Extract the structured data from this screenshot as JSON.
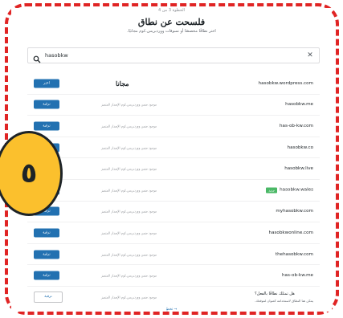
{
  "header": {
    "step": "الخطوة 3 من 4",
    "title": "فلسحت عن نطاق",
    "subtitle": "اختر نطاقًا مخصصًا أو نسوقات ووردبريس.كوم مجانيًا."
  },
  "search": {
    "value": "hasobkw",
    "icon": "search-icon",
    "clear_icon": "close-icon",
    "clear_glyph": "✕"
  },
  "rows": [
    {
      "domain": "hasobkw.wordpress.com",
      "price": "مجانا",
      "button": "اختر",
      "badge": ""
    },
    {
      "domain": "hasobkw.me",
      "price": "موجود ضمن ووردبريس.كوم الإصدار المتميز",
      "button": "ترقية",
      "badge": ""
    },
    {
      "domain": "has-ob-kw.com",
      "price": "موجود ضمن ووردبريس.كوم الإصدار المتميز",
      "button": "ترقية",
      "badge": ""
    },
    {
      "domain": "hasobkw.co",
      "price": "موجود ضمن ووردبريس.كوم الإصدار المتميز",
      "button": "ترقية",
      "badge": ""
    },
    {
      "domain": "hasobkw.live",
      "price": "موجود ضمن ووردبريس.كوم الإصدار المتميز",
      "button": "ترقية",
      "badge": ""
    },
    {
      "domain": "hasobkw.wales",
      "price": "موجود ضمن ووردبريس.كوم الإصدار المتميز",
      "button": "ترقية",
      "badge": "جديد"
    },
    {
      "domain": "myhasobkw.com",
      "price": "موجود ضمن ووردبريس.كوم الإصدار المتميز",
      "button": "ترقية",
      "badge": ""
    },
    {
      "domain": "hasobkwonline.com",
      "price": "موجود ضمن ووردبريس.كوم الإصدار المتميز",
      "button": "ترقية",
      "badge": ""
    },
    {
      "domain": "thehasobkw.com",
      "price": "موجود ضمن ووردبريس.كوم الإصدار المتميز",
      "button": "ترقية",
      "badge": ""
    },
    {
      "domain": "has-ob-kw.me",
      "price": "موجود ضمن ووردبريس.كوم الإصدار المتميز",
      "button": "ترقية",
      "badge": ""
    }
  ],
  "own_domain": {
    "question": "هل تمتلك نطاقًا بالفعل؟",
    "description": "يمكن هنا النطاق لاستخدامه كعنوان لموقعك.",
    "price": "موجود ضمن ووردبريس.كوم الإصدار المتميز",
    "button": "ترقية"
  },
  "skip": "تخطٍ →",
  "overlay": {
    "number": "٥",
    "fill": "#fbc02d"
  },
  "colors": {
    "accent": "#2271b1",
    "frame": "#e02424",
    "badge": "#4ab866"
  }
}
